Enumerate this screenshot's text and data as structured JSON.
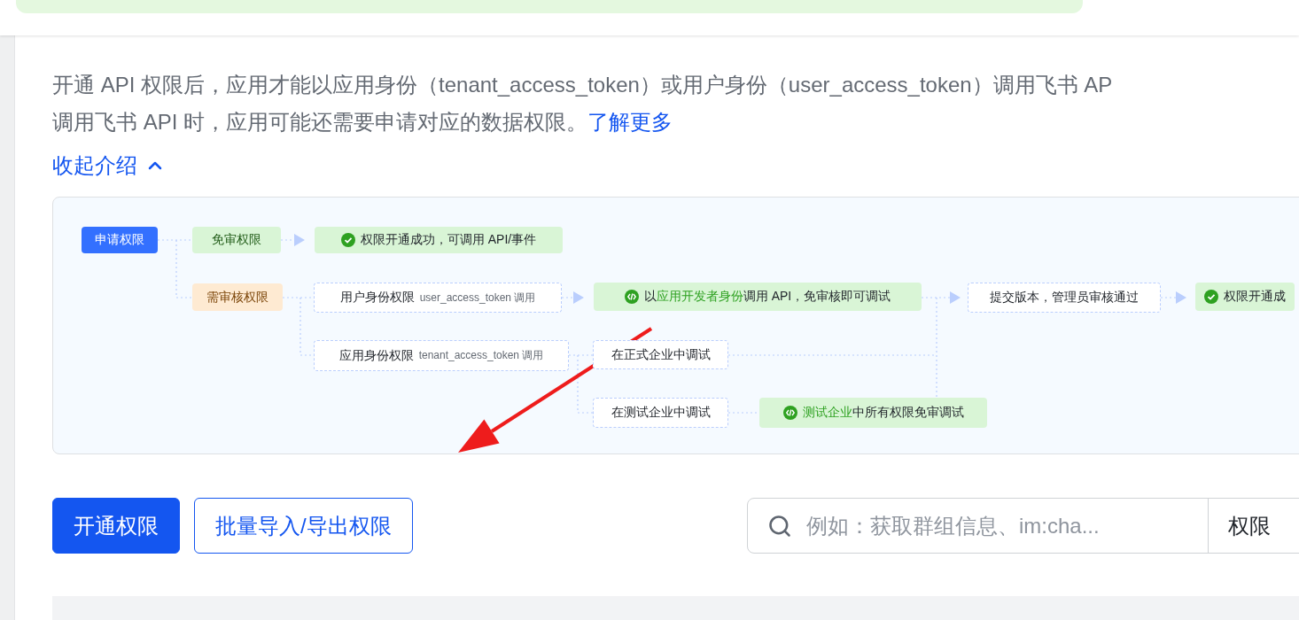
{
  "description": {
    "lines": [
      "开通 API 权限后，应用才能以应用身份（tenant_access_token）或用户身份（user_access_token）调用飞书 AP",
      "调用飞书 API 时，应用可能还需要申请对应的数据权限。"
    ],
    "link": "了解更多"
  },
  "intro_toggle": {
    "label": "收起介绍",
    "expanded": true
  },
  "flow_diagram": {
    "nodes": [
      {
        "kind": "start",
        "parts": [
          {
            "text": "申请权限",
            "highlight": false
          }
        ]
      },
      {
        "kind": "free",
        "parts": [
          {
            "text": "免审权限",
            "highlight": false
          }
        ]
      },
      {
        "kind": "success",
        "parts": [
          {
            "text": "权限开通成功，可调用 API/事件",
            "highlight": false
          }
        ]
      },
      {
        "kind": "review",
        "parts": [
          {
            "text": "需审核权限",
            "highlight": false
          }
        ]
      },
      {
        "kind": "step",
        "parts": [
          {
            "text": "用户身份权限",
            "highlight": false
          }
        ],
        "sublabel": "user_access_token 调用"
      },
      {
        "kind": "dev",
        "parts": [
          {
            "text": "以",
            "highlight": false
          },
          {
            "text": "应用开发者身份",
            "highlight": true
          },
          {
            "text": "调用 API，免审核即可调试",
            "highlight": false
          }
        ]
      },
      {
        "kind": "step",
        "parts": [
          {
            "text": "提交版本，管理员审核通过",
            "highlight": false
          }
        ]
      },
      {
        "kind": "success",
        "parts": [
          {
            "text": "权限开通成",
            "highlight": false
          }
        ]
      },
      {
        "kind": "step",
        "parts": [
          {
            "text": "应用身份权限",
            "highlight": false
          }
        ],
        "sublabel": "tenant_access_token 调用"
      },
      {
        "kind": "step",
        "parts": [
          {
            "text": "在正式企业中调试",
            "highlight": false
          }
        ]
      },
      {
        "kind": "step",
        "parts": [
          {
            "text": "在测试企业中调试",
            "highlight": false
          }
        ]
      },
      {
        "kind": "dev",
        "parts": [
          {
            "text": "测试企业",
            "highlight": true
          },
          {
            "text": "中所有权限免审调试",
            "highlight": false
          }
        ]
      }
    ]
  },
  "actions": {
    "buttons": [
      {
        "label": "开通权限",
        "kind": "primary"
      },
      {
        "label": "批量导入/导出权限",
        "kind": "outline"
      }
    ],
    "search": {
      "placeholder": "例如：获取群组信息、im:cha..."
    },
    "filter": {
      "value": "权限"
    }
  }
}
